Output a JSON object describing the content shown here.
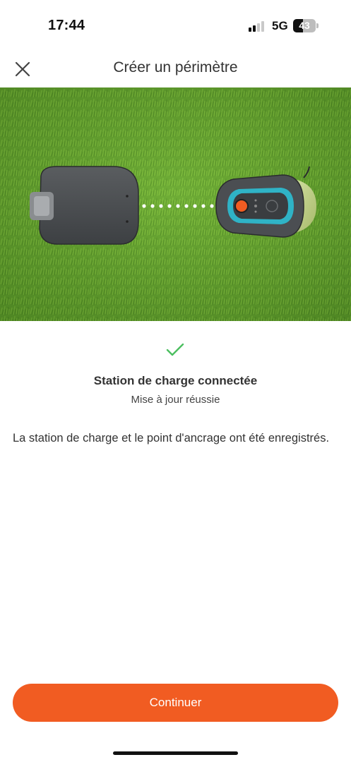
{
  "status_bar": {
    "time": "17:44",
    "network": "5G",
    "battery_level": "43",
    "battery_fraction": 0.43,
    "signal_bars_active": 2,
    "signal_bars_total": 4
  },
  "header": {
    "title": "Créer un périmètre",
    "close_icon": "close-icon"
  },
  "hero": {
    "image": "charging-station-and-mower-illustration"
  },
  "result": {
    "icon": "checkmark-icon",
    "title": "Station de charge connectée",
    "subtitle": "Mise à jour réussie",
    "description": "La station de charge et le point d'ancrage ont été enregistrés."
  },
  "footer": {
    "continue_label": "Continuer"
  },
  "colors": {
    "accent": "#f15c22",
    "success": "#4cbf60",
    "teal": "#2fb3c6"
  }
}
